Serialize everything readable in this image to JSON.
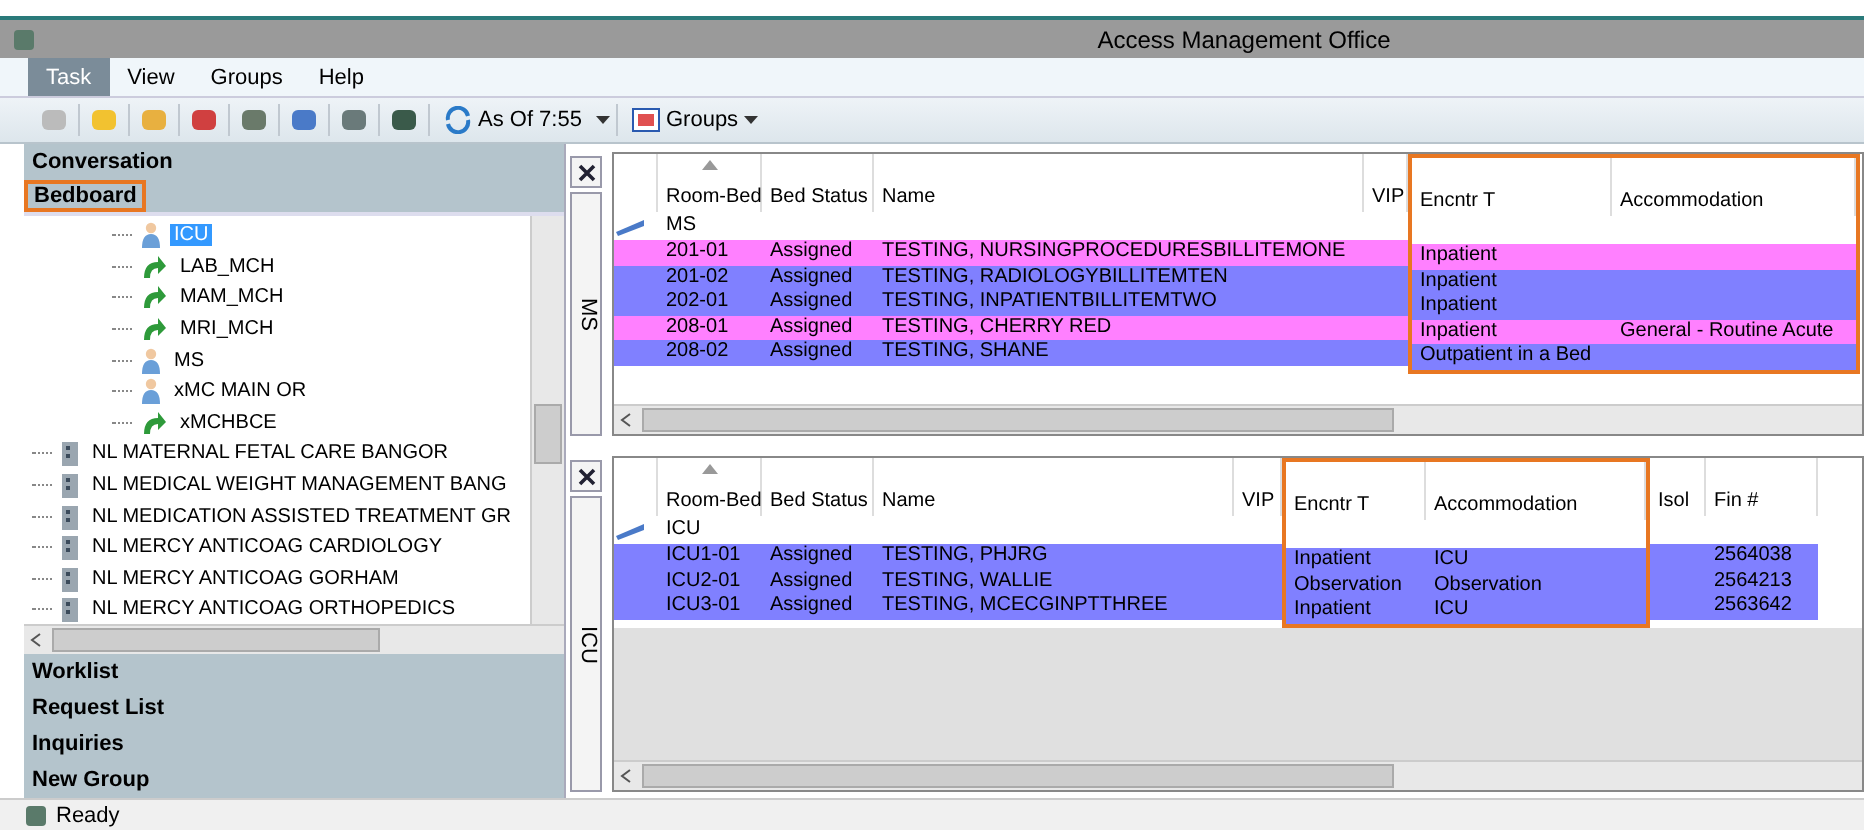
{
  "window": {
    "title": "Access Management Office"
  },
  "menu": [
    {
      "label": "Task",
      "selected": true
    },
    {
      "label": "View",
      "selected": false
    },
    {
      "label": "Groups",
      "selected": false
    },
    {
      "label": "Help",
      "selected": false
    }
  ],
  "toolbar": {
    "as_of": "As Of 7:55",
    "groups": "Groups"
  },
  "sidebar": {
    "top_sections": [
      {
        "label": "Conversation",
        "highlighted": false
      },
      {
        "label": "Bedboard",
        "highlighted": true
      }
    ],
    "tree": [
      {
        "children": [
          {
            "kind": "unit",
            "label": "ICU",
            "selected": true
          },
          {
            "kind": "ambulatory",
            "label": "LAB_MCH",
            "selected": false
          },
          {
            "kind": "ambulatory",
            "label": "MAM_MCH",
            "selected": false
          },
          {
            "kind": "ambulatory",
            "label": "MRI_MCH",
            "selected": false
          },
          {
            "kind": "unit",
            "label": "MS",
            "selected": false
          },
          {
            "kind": "unit",
            "label": "xMC MAIN OR",
            "selected": false
          },
          {
            "kind": "ambulatory",
            "label": "xMCHBCE",
            "selected": false
          }
        ]
      },
      {
        "kind": "facility",
        "label": "NL MATERNAL FETAL CARE BANGOR",
        "selected": false
      },
      {
        "kind": "facility",
        "label": "NL MEDICAL WEIGHT MANAGEMENT BANG",
        "selected": false
      },
      {
        "kind": "facility",
        "label": "NL MEDICATION ASSISTED TREATMENT GR",
        "selected": false
      },
      {
        "kind": "facility",
        "label": "NL MERCY ANTICOAG CARDIOLOGY",
        "selected": false
      },
      {
        "kind": "facility",
        "label": "NL MERCY ANTICOAG GORHAM",
        "selected": false
      },
      {
        "kind": "facility",
        "label": "NL MERCY ANTICOAG ORTHOPEDICS",
        "selected": false
      }
    ],
    "bottom_sections": [
      "Worklist",
      "Request List",
      "Inquiries",
      "New Group"
    ]
  },
  "panes": [
    {
      "tab": "MS",
      "columns": [
        {
          "label": "Room-Bed",
          "sorted": true,
          "highlighted": false
        },
        {
          "label": "Bed Status",
          "sorted": false,
          "highlighted": false
        },
        {
          "label": "Name",
          "sorted": false,
          "highlighted": false
        },
        {
          "label": "VIP",
          "sorted": false,
          "highlighted": false
        },
        {
          "label": "Encntr T",
          "sorted": false,
          "highlighted": true
        },
        {
          "label": "Accommodation",
          "sorted": false,
          "highlighted": true
        }
      ],
      "group": "MS",
      "rows": [
        {
          "color": "#ff80ff",
          "cells": [
            "201-01",
            "Assigned",
            "TESTING, NURSINGPROCEDURESBILLITEMONE",
            null,
            "Inpatient",
            null
          ]
        },
        {
          "color": "#8080ff",
          "cells": [
            "201-02",
            "Assigned",
            "TESTING, RADIOLOGYBILLITEMTEN",
            null,
            "Inpatient",
            null
          ]
        },
        {
          "color": "#8080ff",
          "cells": [
            "202-01",
            "Assigned",
            "TESTING, INPATIENTBILLITEMTWO",
            null,
            "Inpatient",
            null
          ]
        },
        {
          "color": "#ff80ff",
          "cells": [
            "208-01",
            "Assigned",
            "TESTING, CHERRY RED",
            null,
            "Inpatient",
            "General - Routine Acute"
          ]
        },
        {
          "color": "#8080ff",
          "cells": [
            "208-02",
            "Assigned",
            "TESTING, SHANE",
            null,
            "Outpatient in a Bed",
            null
          ]
        }
      ]
    },
    {
      "tab": "ICU",
      "columns": [
        {
          "label": "Room-Bed",
          "sorted": true,
          "highlighted": false
        },
        {
          "label": "Bed Status",
          "sorted": false,
          "highlighted": false
        },
        {
          "label": "Name",
          "sorted": false,
          "highlighted": false
        },
        {
          "label": "VIP",
          "sorted": false,
          "highlighted": false
        },
        {
          "label": "Encntr T",
          "sorted": false,
          "highlighted": true
        },
        {
          "label": "Accommodation",
          "sorted": false,
          "highlighted": true
        },
        {
          "label": "Isol",
          "sorted": false,
          "highlighted": false
        },
        {
          "label": "Fin #",
          "sorted": false,
          "highlighted": false
        }
      ],
      "group": "ICU",
      "rows": [
        {
          "color": "#8080ff",
          "cells": [
            "ICU1-01",
            "Assigned",
            "TESTING, PHJRG",
            null,
            "Inpatient",
            "ICU",
            null,
            "2564038"
          ]
        },
        {
          "color": "#8080ff",
          "cells": [
            "ICU2-01",
            "Assigned",
            "TESTING, WALLIE",
            null,
            "Observation",
            "Observation",
            null,
            "2564213"
          ]
        },
        {
          "color": "#8080ff",
          "cells": [
            "ICU3-01",
            "Assigned",
            "TESTING, MCECGINPTTHREE",
            null,
            "Inpatient",
            "ICU",
            null,
            "2563642"
          ]
        }
      ]
    }
  ],
  "status_bar": "Ready"
}
